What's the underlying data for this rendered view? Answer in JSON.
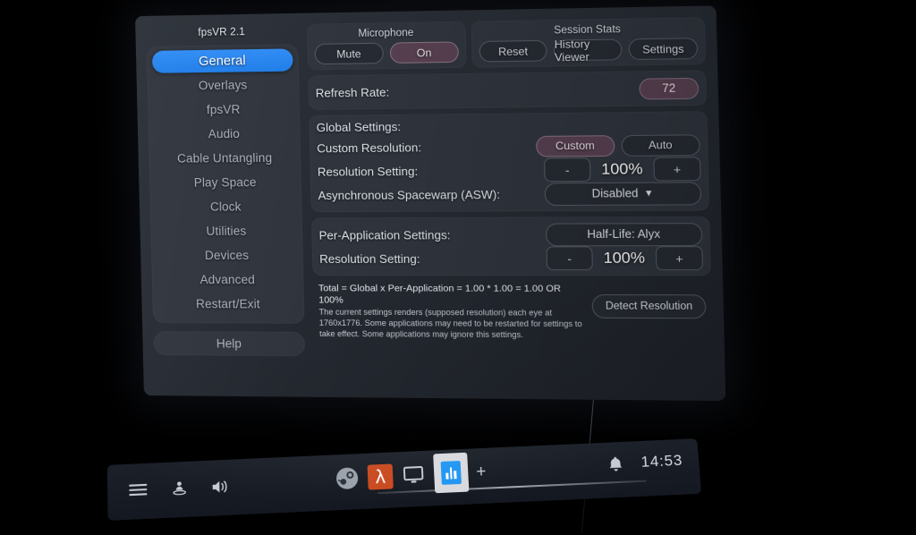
{
  "app": {
    "title": "fpsVR 2.1"
  },
  "sidebar": {
    "items": [
      {
        "label": "General",
        "active": true
      },
      {
        "label": "Overlays",
        "active": false
      },
      {
        "label": "fpsVR",
        "active": false
      },
      {
        "label": "Audio",
        "active": false
      },
      {
        "label": "Cable Untangling",
        "active": false
      },
      {
        "label": "Play Space",
        "active": false
      },
      {
        "label": "Clock",
        "active": false
      },
      {
        "label": "Utilities",
        "active": false
      },
      {
        "label": "Devices",
        "active": false
      },
      {
        "label": "Advanced",
        "active": false
      },
      {
        "label": "Restart/Exit",
        "active": false
      }
    ],
    "help_label": "Help"
  },
  "microphone": {
    "header": "Microphone",
    "mute_label": "Mute",
    "on_label": "On",
    "selected": "On"
  },
  "session_stats": {
    "header": "Session Stats",
    "reset_label": "Reset",
    "history_label": "History Viewer",
    "settings_label": "Settings"
  },
  "refresh_rate": {
    "label": "Refresh Rate:",
    "value": "72"
  },
  "global": {
    "header": "Global Settings:",
    "custom_resolution_label": "Custom Resolution:",
    "custom_label": "Custom",
    "auto_label": "Auto",
    "selected_mode": "Custom",
    "resolution_label": "Resolution Setting:",
    "minus_label": "-",
    "plus_label": "+",
    "resolution_value": "100%",
    "asw_label": "Asynchronous Spacewarp (ASW):",
    "asw_value": "Disabled",
    "asw_caret": "▼"
  },
  "per_app": {
    "header": "Per-Application Settings:",
    "app_name": "Half-Life: Alyx",
    "resolution_label": "Resolution Setting:",
    "minus_label": "-",
    "plus_label": "+",
    "resolution_value": "100%"
  },
  "info": {
    "total_line": "Total = Global x Per-Application = 1.00 * 1.00 = 1.00 OR 100%",
    "detail_line": "The current settings renders (supposed resolution) each eye at 1760x1776. Some applications may need to be restarted for settings to take effect. Some applications may ignore this settings.",
    "detect_label": "Detect Resolution"
  },
  "taskbar": {
    "clock": "14:53",
    "plus_label": "+",
    "lambda_glyph": "λ",
    "icons": [
      "menu-icon",
      "user-icon",
      "volume-icon",
      "steam-icon",
      "halflife-icon",
      "desktop-icon",
      "fpsvr-icon",
      "add-icon",
      "bell-icon"
    ]
  },
  "colors": {
    "accent_blue": "#2f8cf5",
    "accent_mauve": "#574050",
    "panel_bg": "#2b3038",
    "card_bg": "#2f343d",
    "halflife_orange": "#c9491f",
    "fpsvr_blue": "#2196f3"
  }
}
